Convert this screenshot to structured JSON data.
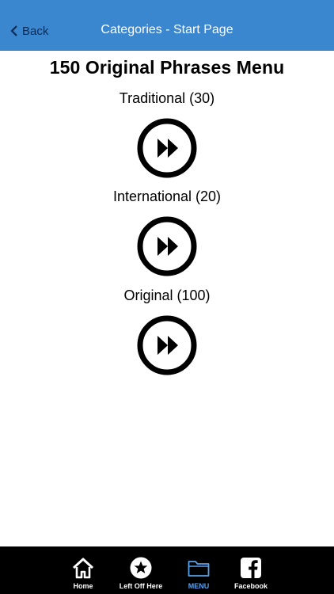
{
  "navbar": {
    "back_label": "Back",
    "title": "Categories - Start Page",
    "color": "#3a86cf"
  },
  "page": {
    "title": "150 Original Phrases Menu"
  },
  "categories": [
    {
      "label": "Traditional (30)",
      "icon": "fast-forward-circle-icon"
    },
    {
      "label": "International (20)",
      "icon": "fast-forward-circle-icon"
    },
    {
      "label": "Original (100)",
      "icon": "fast-forward-circle-icon"
    }
  ],
  "tabbar": {
    "items": [
      {
        "label": "Home",
        "icon": "home-icon",
        "active": false
      },
      {
        "label": "Left Off Here",
        "icon": "star-icon",
        "active": false
      },
      {
        "label": "MENU",
        "icon": "folder-icon",
        "active": true
      },
      {
        "label": "Facebook",
        "icon": "facebook-icon",
        "active": false
      }
    ],
    "active_color": "#5aa0e8"
  }
}
